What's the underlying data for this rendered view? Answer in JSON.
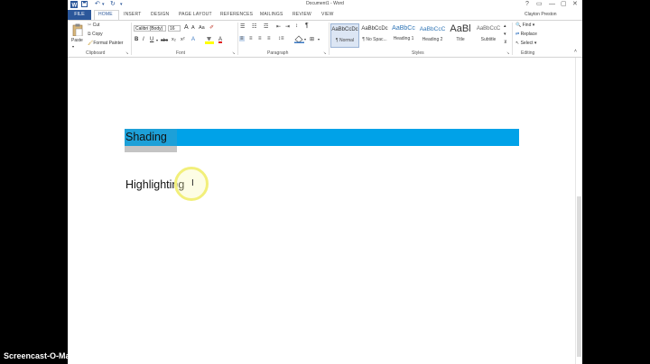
{
  "window": {
    "title": "Document1 - Word",
    "user": "Clayton Preston",
    "controls": [
      "?",
      "▭",
      "—",
      "▢",
      "✕"
    ]
  },
  "tabs": {
    "file": "FILE",
    "items": [
      "HOME",
      "INSERT",
      "DESIGN",
      "PAGE LAYOUT",
      "REFERENCES",
      "MAILINGS",
      "REVIEW",
      "VIEW"
    ],
    "active": "HOME"
  },
  "ribbon": {
    "clipboard": {
      "paste": "Paste",
      "cut": "Cut",
      "copy": "Copy",
      "format_painter": "Format Painter",
      "label": "Clipboard"
    },
    "font": {
      "name": "Calibri (Body)",
      "size": "16",
      "grow": "A",
      "shrink": "A",
      "case": "Aa",
      "bold": "B",
      "italic": "I",
      "underline": "U",
      "strike": "abc",
      "subscript": "x₂",
      "superscript": "x²",
      "label": "Font"
    },
    "paragraph": {
      "label": "Paragraph",
      "pilcrow": "¶"
    },
    "styles": {
      "label": "Styles",
      "items": [
        {
          "preview": "AaBbCcDc",
          "name": "¶ Normal"
        },
        {
          "preview": "AaBbCcDc",
          "name": "¶ No Spac..."
        },
        {
          "preview": "AaBbCc",
          "name": "Heading 1"
        },
        {
          "preview": "AaBbCcC",
          "name": "Heading 2"
        },
        {
          "preview": "AaBl",
          "name": "Title"
        },
        {
          "preview": "AaBbCcC",
          "name": "Subtitle"
        }
      ]
    },
    "editing": {
      "find": "Find",
      "replace": "Replace",
      "select": "Select",
      "label": "Editing"
    }
  },
  "document": {
    "shading_text": "Shading",
    "highlight_text": "Highlighting",
    "shading_color": "#00a2e8",
    "selection_color": "#c4c4c4"
  },
  "watermark": "Screencast-O-Matic.com"
}
